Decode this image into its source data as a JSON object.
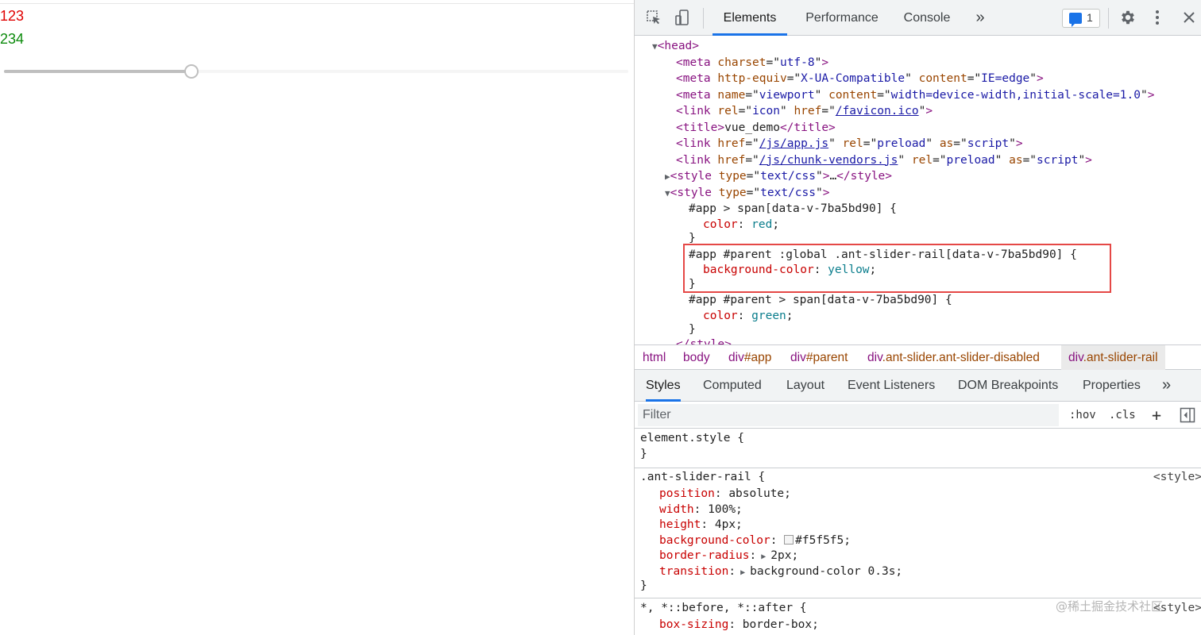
{
  "page": {
    "span_red": "123",
    "span_green": "234",
    "slider": {
      "value_fraction": 0.3
    }
  },
  "devtools": {
    "tabs": [
      "Elements",
      "Performance",
      "Console"
    ],
    "more_tabs_glyph": "»",
    "issues_count": "1",
    "icons": [
      "inspect-icon",
      "device-toolbar-icon",
      "settings-icon",
      "kebab-menu-icon",
      "close-icon"
    ],
    "tree": {
      "head": "head",
      "meta1": {
        "attr": "charset",
        "val": "utf-8"
      },
      "meta2": {
        "attr1": "http-equiv",
        "val1": "X-UA-Compatible",
        "attr2": "content",
        "val2": "IE=edge"
      },
      "meta3": {
        "attr1": "name",
        "val1": "viewport",
        "attr2": "content",
        "val2": "width=device-width,initial-scale=1.0"
      },
      "link1": {
        "attr1": "rel",
        "val1": "icon",
        "attr2": "href",
        "val2": "/favicon.ico"
      },
      "title": "vue_demo",
      "link2": {
        "href": "/js/app.js",
        "rel": "preload",
        "as": "script"
      },
      "link3": {
        "href": "/js/chunk-vendors.js",
        "rel": "preload",
        "as": "script"
      },
      "style_type": "text/css",
      "collapsed_ellipsis": "…",
      "css": {
        "sel1": "#app > span[data-v-7ba5bd90] {",
        "prop1": "color",
        "val1": "red",
        "sel2": "#app #parent :global .ant-slider-rail[data-v-7ba5bd90] {",
        "prop2": "background-color",
        "val2": "yellow",
        "sel3": "#app #parent > span[data-v-7ba5bd90] {",
        "prop3": "color",
        "val3": "green"
      }
    },
    "breadcrumb": [
      {
        "tag": "html",
        "cls": ""
      },
      {
        "tag": "body",
        "cls": ""
      },
      {
        "tag": "div",
        "cls": "#app"
      },
      {
        "tag": "div",
        "cls": "#parent"
      },
      {
        "tag": "div",
        "cls": ".ant-slider.ant-slider-disabled"
      },
      {
        "tag": "div",
        "cls": ".ant-slider-rail"
      }
    ],
    "styles_tabs": [
      "Styles",
      "Computed",
      "Layout",
      "Event Listeners",
      "DOM Breakpoints",
      "Properties"
    ],
    "filter_placeholder": "Filter",
    "hov": ":hov",
    "cls": ".cls",
    "plus": "+",
    "rules": {
      "element_style": "element.style {",
      "close": "}",
      "rail_selector": ".ant-slider-rail {",
      "rail_origin": "<style>",
      "rail_props": [
        {
          "name": "position",
          "value": "absolute;"
        },
        {
          "name": "width",
          "value": "100%;"
        },
        {
          "name": "height",
          "value": "4px;"
        },
        {
          "name": "background-color",
          "value": "#f5f5f5;"
        },
        {
          "name": "border-radius",
          "value": "2px;"
        },
        {
          "name": "transition",
          "value": "background-color 0.3s;"
        }
      ],
      "universal_selector": "*, *::before, *::after {",
      "universal_origin": "<style>",
      "universal_prop": {
        "name": "box-sizing",
        "value": "border-box;"
      }
    },
    "watermark": "@稀土掘金技术社区"
  }
}
